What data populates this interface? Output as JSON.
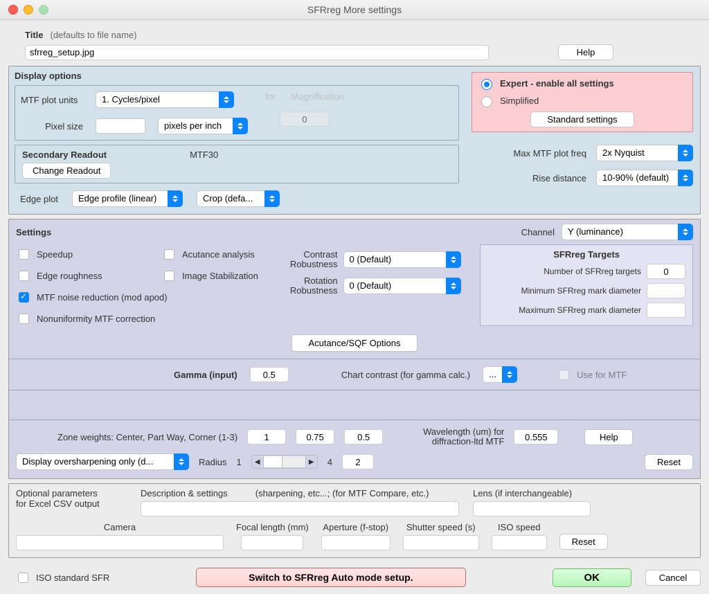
{
  "window": {
    "title": "SFRreg More settings"
  },
  "title": {
    "label": "Title",
    "hint": "(defaults to file name)",
    "value": "sfrreg_setup.jpg",
    "help": "Help"
  },
  "display": {
    "heading": "Display options",
    "mtf_units_label": "MTF plot units",
    "mtf_units_value": "1. Cycles/pixel",
    "for_label": "for",
    "magnification_label": "Magnification",
    "magnification_value": "0",
    "pixel_size_label": "Pixel size",
    "pixel_size_value": "",
    "pixel_unit_value": "pixels per inch",
    "secondary_heading": "Secondary Readout",
    "secondary_value": "MTF30",
    "change_readout": "Change Readout",
    "edge_plot_label": "Edge plot",
    "edge_plot_value": "Edge profile (linear)",
    "crop_value": "Crop (defa...",
    "mode": {
      "expert": "Expert - enable all settings",
      "simplified": "Simplified",
      "standard_btn": "Standard settings"
    },
    "max_freq_label": "Max MTF plot freq",
    "max_freq_value": "2x  Nyquist",
    "rise_label": "Rise distance",
    "rise_value": "10-90% (default)"
  },
  "settings": {
    "heading": "Settings",
    "channel_label": "Channel",
    "channel_value": "Y (luminance)",
    "speedup": "Speedup",
    "acutance": "Acutance analysis",
    "edge_roughness": "Edge roughness",
    "image_stab": "Image Stabilization",
    "mtf_noise": "MTF noise reduction (mod  apod)",
    "nonuniformity": "Nonuniformity MTF correction",
    "contrast_label": "Contrast\nRobustness",
    "contrast_label1": "Contrast",
    "contrast_label2": "Robustness",
    "contrast_value": "0 (Default)",
    "rotation_label1": "Rotation",
    "rotation_label2": "Robustness",
    "rotation_value": "0 (Default)",
    "targets": {
      "heading": "SFRreg Targets",
      "num_label": "Number of SFRreg targets",
      "num_value": "0",
      "min_label": "Minimum SFRreg mark diameter",
      "min_value": "",
      "max_label": "Maximum SFRreg mark diameter",
      "max_value": ""
    },
    "acutance_btn": "Acutance/SQF Options",
    "gamma_label": "Gamma (input)",
    "gamma_value": "0.5",
    "chart_contrast_label": "Chart contrast (for gamma calc.)",
    "chart_contrast_value": "...",
    "use_for_mtf": "Use for MTF",
    "zone_label": "Zone weights:  Center, Part Way, Corner (1-3)",
    "zone1": "1",
    "zone2": "0.75",
    "zone3": "0.5",
    "wavelength_label1": "Wavelength (um) for",
    "wavelength_label2": "diffraction-ltd MTF",
    "wavelength_value": "0.555",
    "help": "Help",
    "reset": "Reset",
    "oversharp_value": "Display oversharpening only  (d...",
    "radius_label": "Radius",
    "radius_min": "1",
    "radius_max": "4",
    "radius_value": "2"
  },
  "output": {
    "heading1": "Optional parameters",
    "heading2": "for Excel CSV output",
    "desc_label": "Description & settings",
    "desc_hint": "(sharpening, etc...; (for MTF Compare, etc.)",
    "lens_label": "Lens (if interchangeable)",
    "camera_label": "Camera",
    "focal_label": "Focal length (mm)",
    "aperture_label": "Aperture (f-stop)",
    "shutter_label": "Shutter speed (s)",
    "iso_label": "ISO speed",
    "reset": "Reset"
  },
  "footer": {
    "iso_sfr": "ISO standard SFR",
    "switch": "Switch to SFRreg Auto mode setup.",
    "ok": "OK",
    "cancel": "Cancel"
  }
}
